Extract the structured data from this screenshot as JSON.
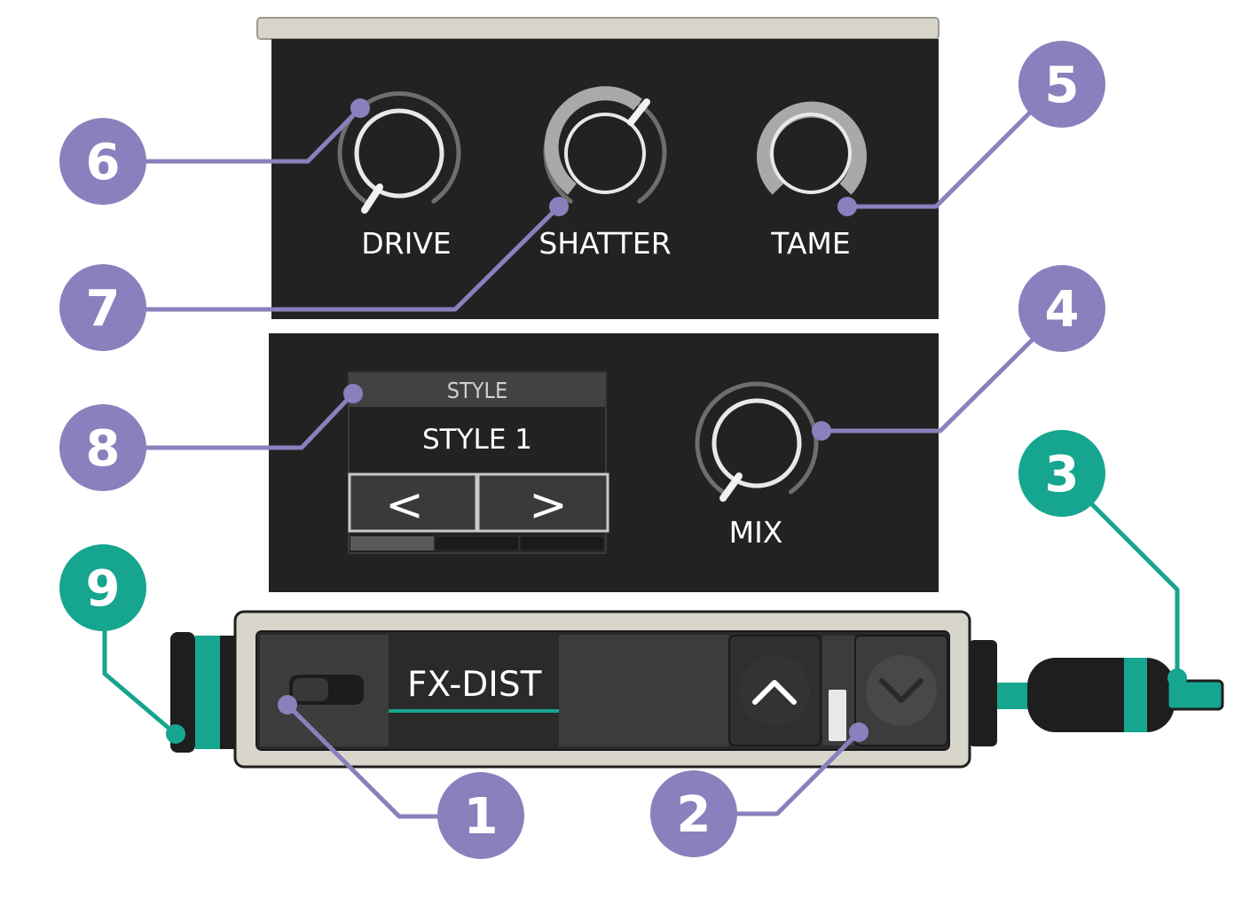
{
  "knobs": {
    "drive": {
      "label": "DRIVE",
      "value": 0.0
    },
    "shatter": {
      "label": "SHATTER",
      "value": 0.7
    },
    "tame": {
      "label": "TAME",
      "value": 1.0
    },
    "mix": {
      "label": "MIX",
      "value": 0.0
    }
  },
  "style_selector": {
    "header": "STYLE",
    "value": "STYLE 1",
    "prev_symbol": "<",
    "next_symbol": ">",
    "page": 1,
    "page_count": 3
  },
  "module_bar": {
    "name": "FX-DIST",
    "up_symbol": "^",
    "down_symbol": "v"
  },
  "callouts": [
    {
      "id": "1",
      "color": "#8a80bd"
    },
    {
      "id": "2",
      "color": "#8a80bd"
    },
    {
      "id": "3",
      "color": "#16a58e"
    },
    {
      "id": "4",
      "color": "#8a80bd"
    },
    {
      "id": "5",
      "color": "#8a80bd"
    },
    {
      "id": "6",
      "color": "#8a80bd"
    },
    {
      "id": "7",
      "color": "#8a80bd"
    },
    {
      "id": "8",
      "color": "#8a80bd"
    },
    {
      "id": "9",
      "color": "#16a58e"
    }
  ],
  "colors": {
    "panel": "#222222",
    "frame": "#d8d6cb",
    "purple": "#8a80bd",
    "teal": "#16a58e"
  }
}
